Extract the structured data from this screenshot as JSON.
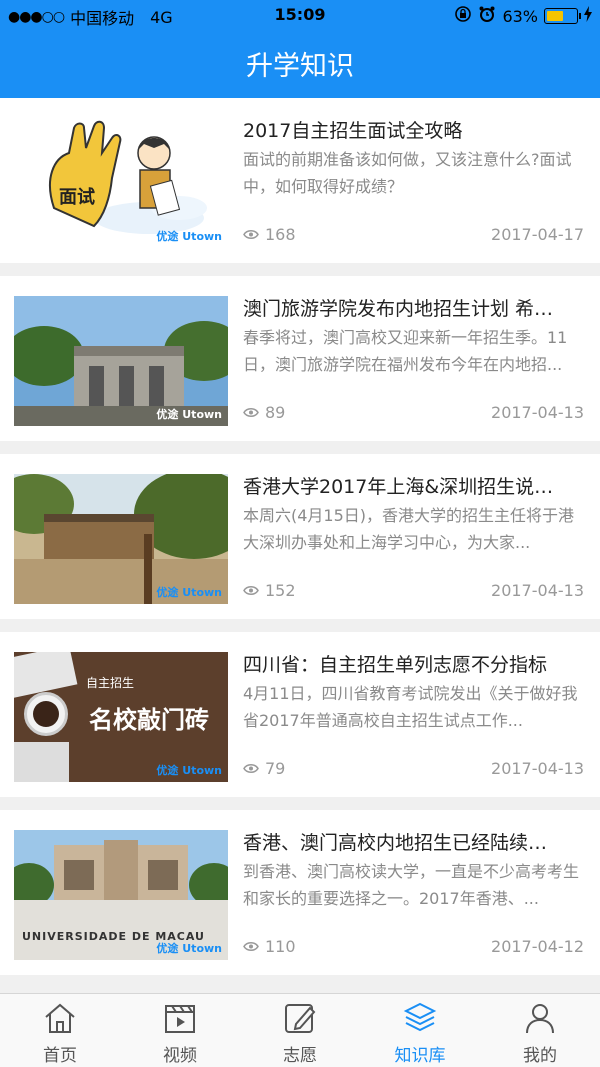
{
  "status_bar": {
    "signal_dots": "●●●○○",
    "carrier": "中国移动",
    "network": "4G",
    "time": "15:09",
    "battery_percent": "63%",
    "battery_level": 0.63,
    "icons": [
      "orientation-lock-icon",
      "alarm-icon",
      "battery-icon",
      "charging-icon"
    ]
  },
  "header": {
    "title": "升学知识"
  },
  "articles": [
    {
      "title": "2017自主招生面试全攻略",
      "summary": "面试的前期准备该如何做，又该注意什么?面试中，如何取得好成绩？",
      "views": "168",
      "date": "2017-04-17",
      "thumb_caption": "面试",
      "thumb_watermark": "优途 Utown"
    },
    {
      "title": "澳门旅游学院发布内地招生计划 希…",
      "summary": "春季将过，澳门高校又迎来新一年招生季。11日，澳门旅游学院在福州发布今年在内地招...",
      "views": "89",
      "date": "2017-04-13",
      "thumb_watermark": "优途 Utown"
    },
    {
      "title": "香港大学2017年上海&深圳招生说…",
      "summary": "本周六(4月15日)，香港大学的招生主任将于港大深圳办事处和上海学习中心，为大家...",
      "views": "152",
      "date": "2017-04-13",
      "thumb_watermark": "优途 Utown"
    },
    {
      "title": "四川省：自主招生单列志愿不分指标",
      "summary": "4月11日，四川省教育考试院发出《关于做好我省2017年普通高校自主招生试点工作...",
      "views": "79",
      "date": "2017-04-13",
      "thumb_caption_small": "自主招生",
      "thumb_caption": "名校敲门砖",
      "thumb_watermark": "优途 Utown"
    },
    {
      "title": "香港、澳门高校内地招生已经陆续…",
      "summary": "到香港、澳门高校读大学，一直是不少高考考生和家长的重要选择之一。2017年香港、...",
      "views": "110",
      "date": "2017-04-12",
      "thumb_caption": "UNIVERSIDADE DE MACAU",
      "thumb_watermark": "优途 Utown"
    }
  ],
  "tab_bar": {
    "active_tab": "知识库",
    "tabs": [
      {
        "label": "首页",
        "icon": "home-icon"
      },
      {
        "label": "视频",
        "icon": "video-icon"
      },
      {
        "label": "志愿",
        "icon": "edit-icon"
      },
      {
        "label": "知识库",
        "icon": "layers-icon"
      },
      {
        "label": "我的",
        "icon": "user-icon"
      }
    ]
  },
  "colors": {
    "accent": "#1a8ff5",
    "text": "#222222",
    "muted": "#999999",
    "battery": "#f5c400"
  }
}
